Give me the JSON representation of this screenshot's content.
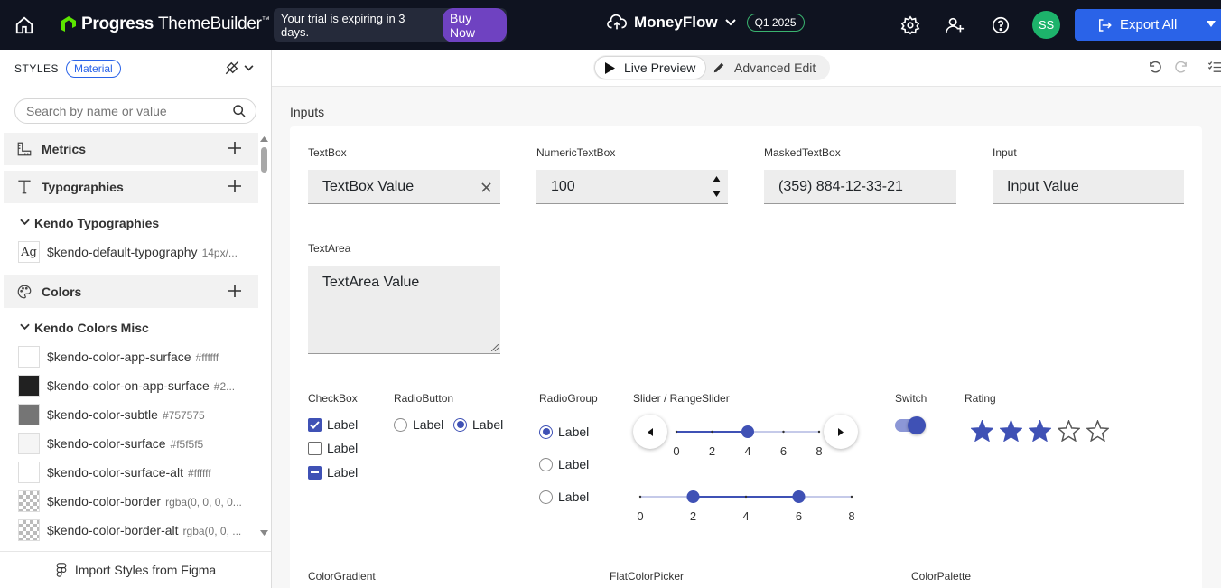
{
  "topbar": {
    "brand_bold": "Progress",
    "brand_light": "ThemeBuilder",
    "brand_tm": "™",
    "trial_text": "Your trial is expiring in 3 days.",
    "buy_label": "Buy Now",
    "project_name": "MoneyFlow",
    "quarter": "Q1 2025",
    "avatar": "SS",
    "export_label": "Export All"
  },
  "sidebar": {
    "styles_label": "STYLES",
    "material_label": "Material",
    "search_placeholder": "Search by name or value",
    "metrics_label": "Metrics",
    "typographies_label": "Typographies",
    "kendo_typographies_label": "Kendo Typographies",
    "typography_item": {
      "name": "$kendo-default-typography",
      "value": "14px/..."
    },
    "colors_label": "Colors",
    "kendo_colors_label": "Kendo Colors Misc",
    "color_items": [
      {
        "name": "$kendo-color-app-surface",
        "value": "#ffffff",
        "color": "#ffffff"
      },
      {
        "name": "$kendo-color-on-app-surface",
        "value": "#2...",
        "color": "#212121"
      },
      {
        "name": "$kendo-color-subtle",
        "value": "#757575",
        "color": "#757575"
      },
      {
        "name": "$kendo-color-surface",
        "value": "#f5f5f5",
        "color": "#f5f5f5"
      },
      {
        "name": "$kendo-color-surface-alt",
        "value": "#ffffff",
        "color": "#ffffff"
      },
      {
        "name": "$kendo-color-border",
        "value": "rgba(0, 0, 0, 0...",
        "color": "transparent"
      },
      {
        "name": "$kendo-color-border-alt",
        "value": "rgba(0, 0, ...",
        "color": "transparent"
      }
    ],
    "figma_label": "Import Styles from Figma"
  },
  "toolbar": {
    "live_preview": "Live Preview",
    "advanced_edit": "Advanced Edit"
  },
  "main": {
    "section_title": "Inputs",
    "textbox": {
      "label": "TextBox",
      "value": "TextBox Value"
    },
    "numeric": {
      "label": "NumericTextBox",
      "value": "100"
    },
    "masked": {
      "label": "MaskedTextBox",
      "value": "(359) 884-12-33-21"
    },
    "input": {
      "label": "Input",
      "value": "Input Value"
    },
    "textarea": {
      "label": "TextArea",
      "value": "TextArea Value"
    },
    "checkbox": {
      "label": "CheckBox",
      "items": [
        "Label",
        "Label",
        "Label"
      ]
    },
    "radiobutton": {
      "label": "RadioButton",
      "items": [
        "Label",
        "Label"
      ]
    },
    "radiogroup": {
      "label": "RadioGroup",
      "items": [
        "Label",
        "Label",
        "Label"
      ]
    },
    "slider": {
      "label": "Slider / RangeSlider",
      "ticks": [
        "0",
        "2",
        "4",
        "6",
        "8"
      ],
      "value": 4,
      "range": [
        2,
        6
      ],
      "max": 8
    },
    "switch": {
      "label": "Switch",
      "on": true
    },
    "rating": {
      "label": "Rating",
      "value": 3,
      "max": 5
    },
    "colorgradient_label": "ColorGradient",
    "flatcolorpicker_label": "FlatColorPicker",
    "colorpalette_label": "ColorPalette",
    "accent": "#3f51b5"
  }
}
